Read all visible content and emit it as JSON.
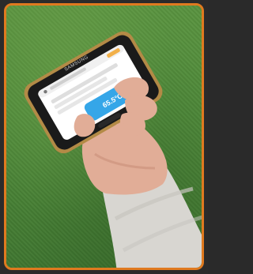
{
  "image": {
    "subject": "hand-holding-smartphone",
    "colors": {
      "border": "#e07a1f",
      "turf": "#4f8a3a",
      "screen_accent": "#35a6e8",
      "phone_gold": "#b38a46"
    }
  },
  "phone": {
    "brand": "SAMSUNG",
    "screen": {
      "temperature": "65.5°C"
    }
  }
}
